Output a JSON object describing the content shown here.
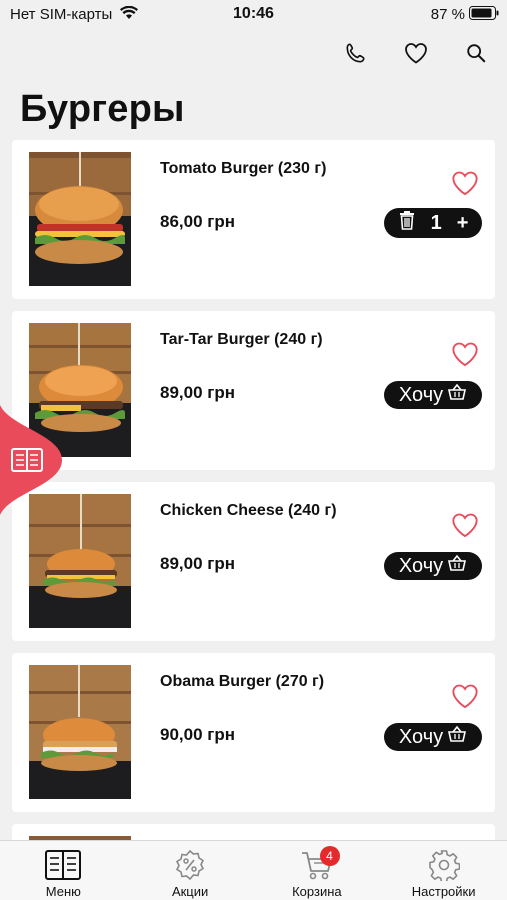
{
  "status": {
    "carrier": "Нет SIM-карты",
    "time": "10:46",
    "battery": "87 %"
  },
  "header": {
    "title": "Бургеры",
    "icons": [
      "phone-icon",
      "heart-icon",
      "search-icon"
    ]
  },
  "products": [
    {
      "name": "Tomato Burger (230 г)",
      "price": "86,00 грн",
      "in_cart": true,
      "quantity": "1"
    },
    {
      "name": "Tar-Tar Burger (240 г)",
      "price": "89,00 грн",
      "in_cart": false,
      "button_label": "Хочу"
    },
    {
      "name": "Chicken Cheese (240 г)",
      "price": "89,00 грн",
      "in_cart": false,
      "button_label": "Хочу"
    },
    {
      "name": "Obama Burger (270 г)",
      "price": "90,00 грн",
      "in_cart": false,
      "button_label": "Хочу"
    }
  ],
  "qty_controls": {
    "minus": "delete",
    "plus": "+"
  },
  "tabs": [
    {
      "label": "Меню",
      "icon": "menu-book-icon"
    },
    {
      "label": "Акции",
      "icon": "discount-icon"
    },
    {
      "label": "Корзина",
      "icon": "cart-icon",
      "badge": "4"
    },
    {
      "label": "Настройки",
      "icon": "gear-icon"
    }
  ],
  "colors": {
    "accent": "#e94b5a",
    "button": "#111111",
    "badge": "#e22b2b",
    "background": "#f0f0f0"
  }
}
